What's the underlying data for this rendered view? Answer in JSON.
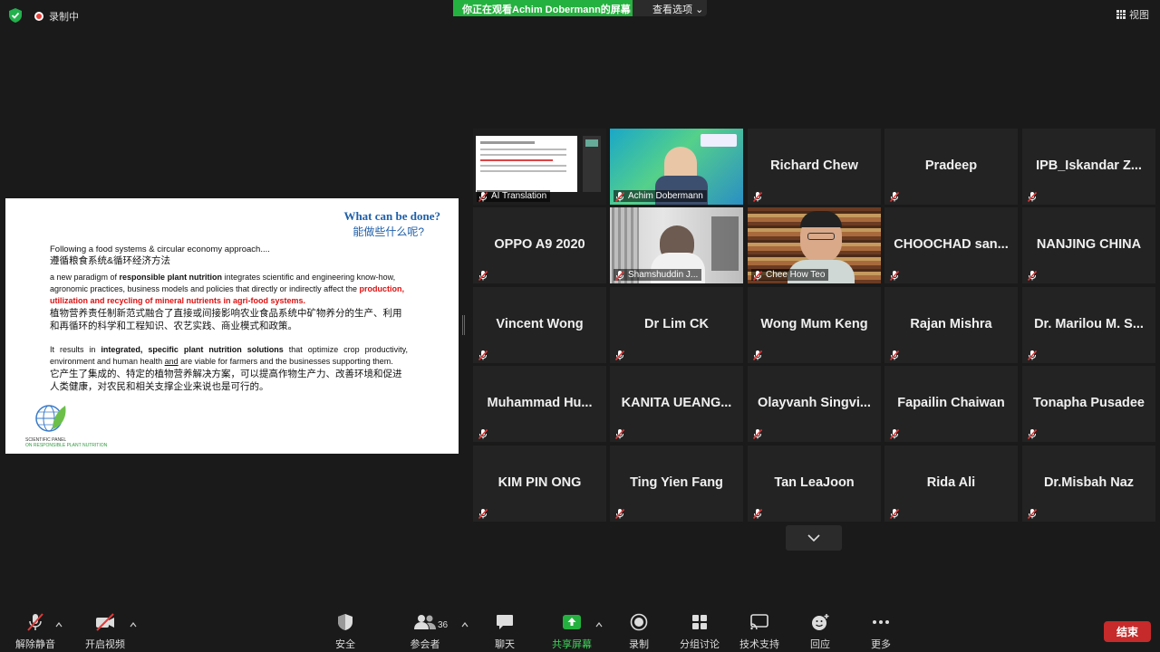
{
  "status": {
    "recording": "录制中"
  },
  "viewing": {
    "banner": "你正在观看Achim  Dobermann的屏幕",
    "options": "查看选项"
  },
  "view_button": "视图",
  "slide": {
    "question_en": "What can be done?",
    "question_zh": "能做些什么呢?",
    "lead_en": "Following a food systems & circular economy approach....",
    "lead_zh": "遵循粮食系统&循环经济方法",
    "p1_a": "a new paradigm of ",
    "p1_b": "responsible plant nutrition",
    "p1_c": " integrates scientific and engineering know-how, agronomic practices, business models and policies that directly or indirectly affect the ",
    "p1_red": "production, utilization and recycling of mineral nutrients in agri-food systems.",
    "p1_zh": "植物营养责任制新范式融合了直接或间接影响农业食品系统中矿物养分的生产、利用和再循环的科学和工程知识、农艺实践、商业模式和政策。",
    "p2_a": "It results in ",
    "p2_b": "integrated, specific plant nutrition solutions",
    "p2_c": " that optimize crop productivity, environment and human health ",
    "p2_u": "and",
    "p2_d": " are viable for farmers and the businesses supporting them.",
    "p2_zh": "它产生了集成的、特定的植物营养解决方案，可以提高作物生产力、改善环境和促进人类健康，对农民和相关支撑企业来说也是可行的。",
    "logo_line1": "SCIENTIFIC PANEL",
    "logo_line2": "ON RESPONSIBLE PLANT NUTRITION"
  },
  "participants": [
    {
      "name": "AI Translation",
      "type": "share"
    },
    {
      "name": "Achim Dobermann",
      "type": "speaker"
    },
    {
      "name": "Richard Chew",
      "type": "name"
    },
    {
      "name": "Pradeep",
      "type": "name"
    },
    {
      "name": "IPB_Iskandar  Z...",
      "type": "name"
    },
    {
      "name": "OPPO A9 2020",
      "type": "name"
    },
    {
      "name": "Shamshuddin J...",
      "type": "video-a"
    },
    {
      "name": "Chee How Teo",
      "type": "video-b"
    },
    {
      "name": "CHOOCHAD  san...",
      "type": "name"
    },
    {
      "name": "NANJING CHINA",
      "type": "name"
    },
    {
      "name": "Vincent Wong",
      "type": "name"
    },
    {
      "name": "Dr Lim CK",
      "type": "name"
    },
    {
      "name": "Wong Mum Keng",
      "type": "name"
    },
    {
      "name": "Rajan Mishra",
      "type": "name"
    },
    {
      "name": "Dr. Marilou M. S...",
      "type": "name"
    },
    {
      "name": "Muhammad  Hu...",
      "type": "name"
    },
    {
      "name": "KANITA  UEANG...",
      "type": "name"
    },
    {
      "name": "Olayvanh  Singvi...",
      "type": "name"
    },
    {
      "name": "Fapailin Chaiwan",
      "type": "name"
    },
    {
      "name": "Tonapha Pusadee",
      "type": "name"
    },
    {
      "name": "KIM PIN ONG",
      "type": "name"
    },
    {
      "name": "Ting Yien Fang",
      "type": "name"
    },
    {
      "name": "Tan LeaJoon",
      "type": "name"
    },
    {
      "name": "Rida Ali",
      "type": "name"
    },
    {
      "name": "Dr.Misbah  Naz",
      "type": "name"
    }
  ],
  "toolbar": {
    "unmute": "解除静音",
    "start_video": "开启视频",
    "security": "安全",
    "participants": "参会者",
    "participant_count": "36",
    "chat": "聊天",
    "share": "共享屏幕",
    "record": "录制",
    "breakout": "分组讨论",
    "support": "技术支持",
    "reactions": "回应",
    "more": "更多",
    "end": "结束"
  },
  "colors": {
    "accent_green": "#25b13f",
    "end_red": "#c62a2a",
    "mute_red": "#e03a3a",
    "speaker_outline": "#d8e24a"
  }
}
